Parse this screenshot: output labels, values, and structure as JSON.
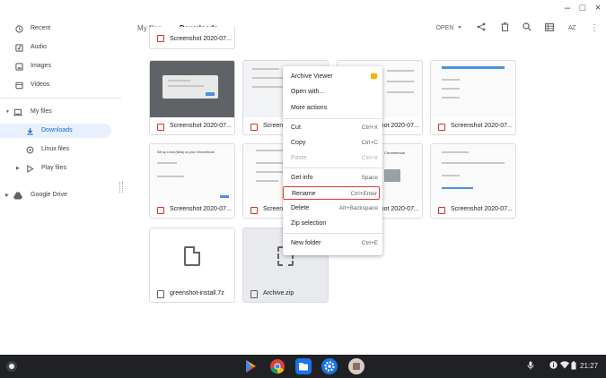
{
  "window": {
    "minimize": "–",
    "maximize": "□",
    "close": "×"
  },
  "sidebar": {
    "items": [
      {
        "label": "Recent",
        "icon": "clock-icon"
      },
      {
        "label": "Audio",
        "icon": "audio-icon"
      },
      {
        "label": "Images",
        "icon": "image-icon"
      },
      {
        "label": "Videos",
        "icon": "video-icon"
      },
      {
        "label": "My files",
        "icon": "laptop-icon"
      },
      {
        "label": "Downloads",
        "icon": "download-icon"
      },
      {
        "label": "Linux files",
        "icon": "linux-icon"
      },
      {
        "label": "Play files",
        "icon": "play-icon"
      },
      {
        "label": "Google Drive",
        "icon": "drive-icon"
      }
    ]
  },
  "breadcrumb": {
    "root": "My files",
    "sep": "›",
    "current": "Downloads"
  },
  "toolbar": {
    "open_label": "OPEN",
    "sort_label": "AZ"
  },
  "files": [
    {
      "name": "Screenshot 2020-07..."
    },
    {
      "name": "Screenshot 2020-07..."
    },
    {
      "name": "Screenshot 2020-07..."
    },
    {
      "name": "Screenshot 2020-07..."
    },
    {
      "name": "Screenshot 2020-07..."
    },
    {
      "name": "Screenshot 2020-07..."
    },
    {
      "name": "Screenshot 2020-07..."
    },
    {
      "name": "Screenshot 2020-07..."
    },
    {
      "name": "Screenshot 2020-07..."
    },
    {
      "name": "greenshot-install.7z"
    },
    {
      "name": "Archive.zip"
    }
  ],
  "thumb_texts": {
    "linux_title": "Set up Linux (Beta) on your Chromebook",
    "chromebook": "Chromebook"
  },
  "context_menu": {
    "items": [
      {
        "label": "Archive Viewer",
        "shortcut": ""
      },
      {
        "label": "Open with...",
        "shortcut": ""
      },
      {
        "label": "More actions",
        "shortcut": ""
      },
      {
        "label": "Cut",
        "shortcut": "Ctrl+X"
      },
      {
        "label": "Copy",
        "shortcut": "Ctrl+C"
      },
      {
        "label": "Paste",
        "shortcut": "Ctrl+V"
      },
      {
        "label": "Get info",
        "shortcut": "Space"
      },
      {
        "label": "Rename",
        "shortcut": "Ctrl+Enter"
      },
      {
        "label": "Delete",
        "shortcut": "Alt+Backspace"
      },
      {
        "label": "Zip selection",
        "shortcut": ""
      },
      {
        "label": "New folder",
        "shortcut": "Ctrl+E"
      }
    ]
  },
  "shelf": {
    "time": "21:27"
  },
  "colors": {
    "accent": "#1967d2",
    "highlight_border": "#e53935",
    "shelf": "#202124"
  }
}
